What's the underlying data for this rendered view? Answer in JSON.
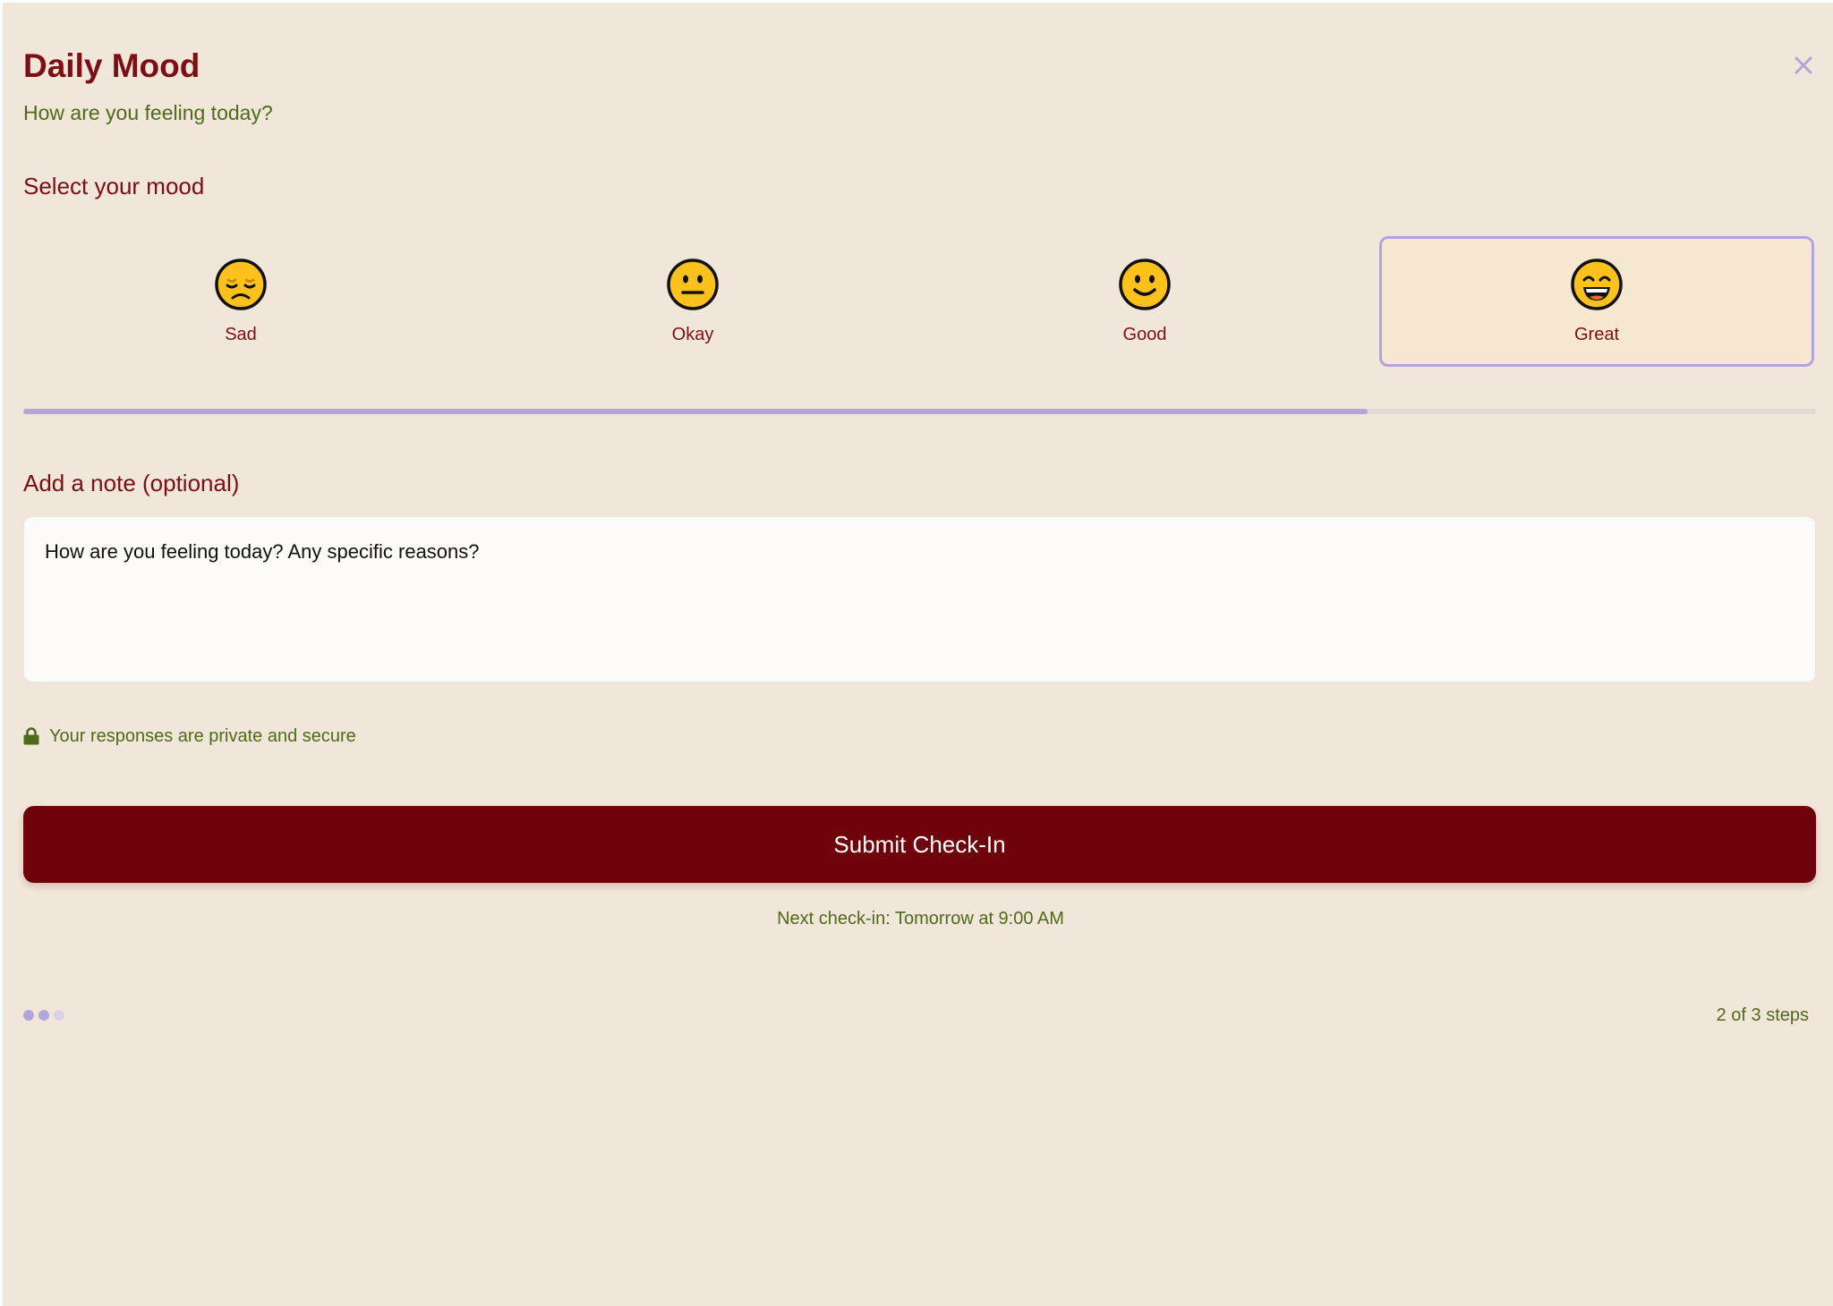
{
  "header": {
    "title": "Daily Mood",
    "subtitle": "How are you feeling today?"
  },
  "close_icon": "close-icon",
  "mood_section": {
    "label": "Select your mood",
    "selected": "Great",
    "options": [
      {
        "label": "Sad",
        "icon": "pensive-face-icon"
      },
      {
        "label": "Okay",
        "icon": "neutral-face-icon"
      },
      {
        "label": "Good",
        "icon": "smiling-face-icon"
      },
      {
        "label": "Great",
        "icon": "grinning-face-icon"
      }
    ]
  },
  "progress": {
    "value_percent": 75
  },
  "note_section": {
    "label": "Add a note (optional)",
    "placeholder": "How are you feeling today? Any specific reasons?"
  },
  "privacy": {
    "icon": "lock-icon",
    "text": "Your responses are private and secure"
  },
  "submit": {
    "label": "Submit Check-In"
  },
  "next_checkin": "Next check-in: Tomorrow at 9:00 AM",
  "steps": {
    "current": 2,
    "total": 3,
    "label": "2 of 3 steps"
  },
  "colors": {
    "background": "#f1e6da",
    "primary": "#7c0f14",
    "button": "#6f030b",
    "accent": "#b3a4dc",
    "secondary_text": "#4f6a18",
    "selected_card": "#f5e7d0"
  }
}
